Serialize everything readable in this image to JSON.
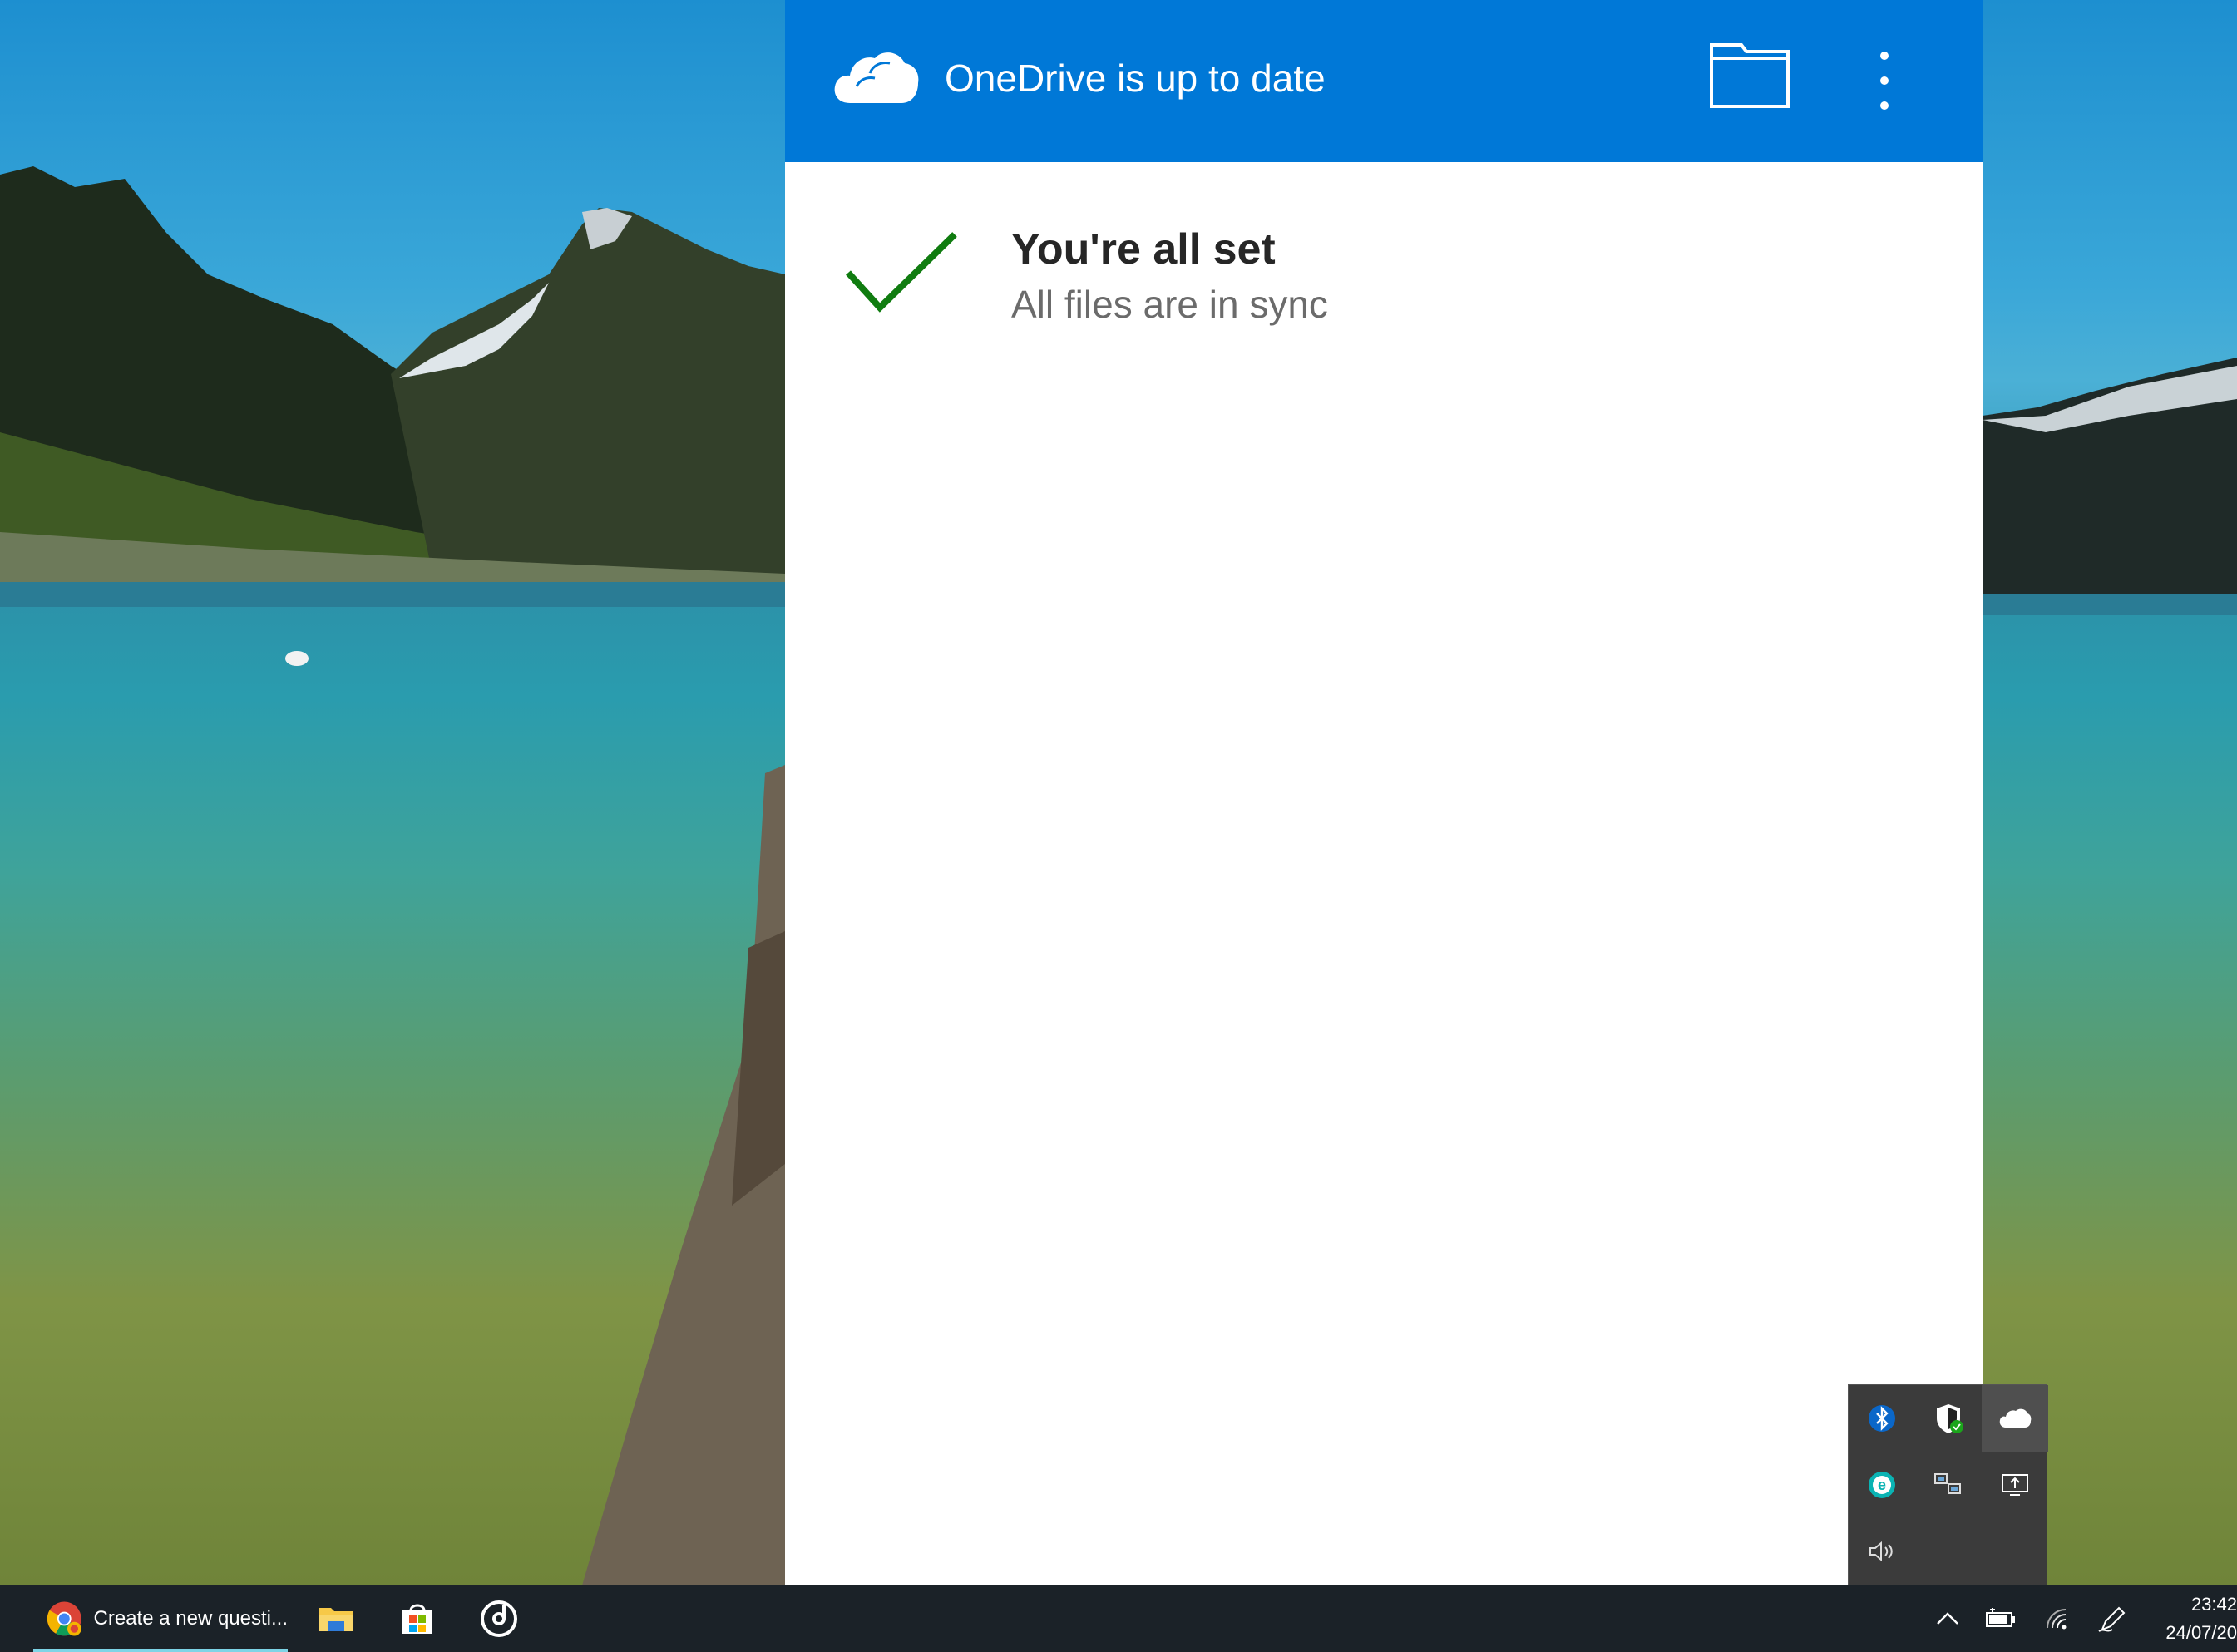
{
  "flyout": {
    "title": "OneDrive is up to date",
    "status_title": "You're all set",
    "status_subtitle": "All files are in sync"
  },
  "icons": {
    "onedrive": "cloud-icon",
    "open_folder": "folder-icon",
    "more": "more-vertical-icon",
    "status": "checkmark-icon",
    "tray_overflow": [
      "bluetooth-icon",
      "security-shield-icon",
      "onedrive-tray-icon",
      "eset-icon",
      "network-share-icon",
      "display-upload-icon",
      "speaker-icon"
    ],
    "taskbar_pinned": [
      "file-explorer-icon",
      "microsoft-store-icon",
      "groove-music-icon"
    ],
    "system_tray": [
      "chevron-up-icon",
      "battery-icon",
      "wifi-icon",
      "pen-icon"
    ]
  },
  "taskbar": {
    "chrome_window_label": "Create a new questi..."
  },
  "clock": {
    "time": "23:42",
    "date": "24/07/20"
  },
  "colors": {
    "accent": "#0078d7",
    "check": "#107c10",
    "taskbar": "#1b2228"
  }
}
